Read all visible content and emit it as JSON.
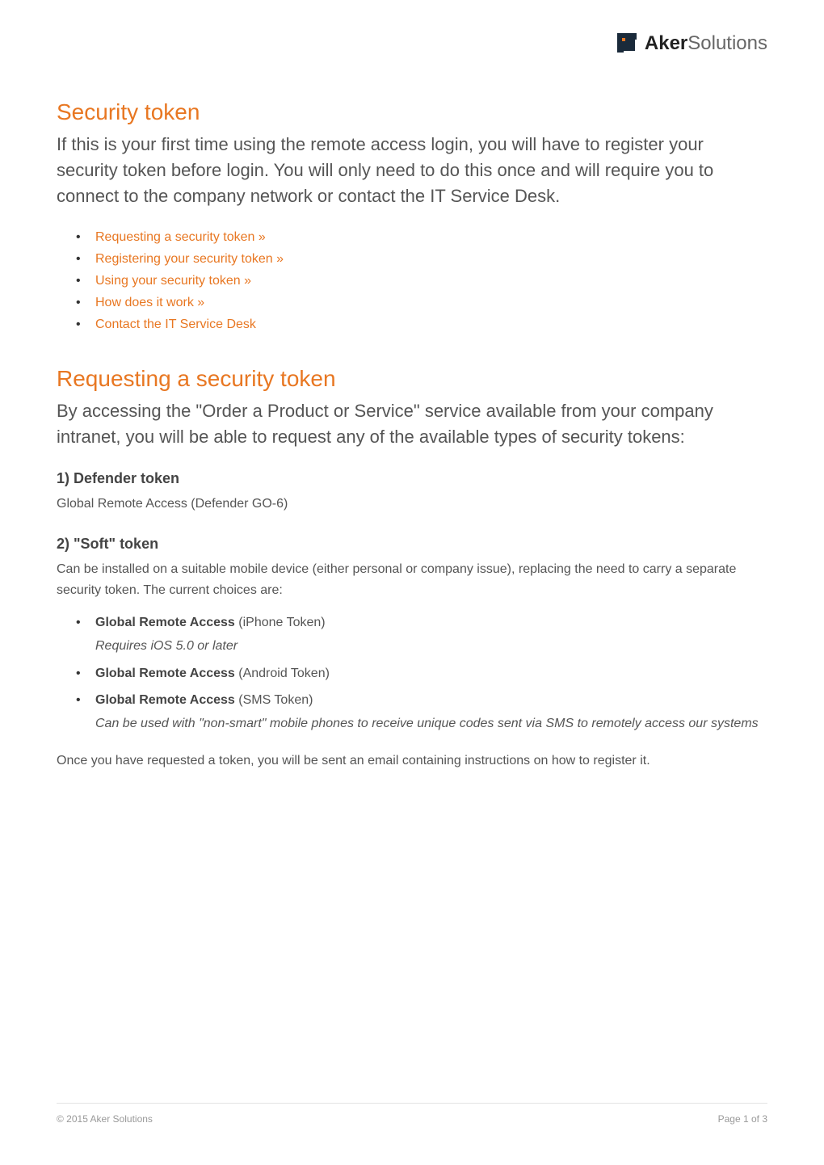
{
  "logo": {
    "brand_bold": "Aker",
    "brand_light": "Solutions"
  },
  "section1": {
    "title": "Security token",
    "intro": "If this is your first time using the remote access login, you will have to register your security token before login. You will only need to do this once and will require you to connect to the company network or contact the IT Service Desk.",
    "links": [
      "Requesting a security token »",
      "Registering your security token »",
      "Using your security token »",
      "How does it work »",
      "Contact the IT Service Desk"
    ]
  },
  "section2": {
    "title": "Requesting a security token",
    "intro": "By accessing the \"Order a Product or Service\" service available from your company intranet, you will be able to request any of the available types of security tokens:",
    "sub1": {
      "heading": "1) Defender token",
      "body": "Global Remote Access (Defender GO-6)"
    },
    "sub2": {
      "heading": "2) \"Soft\" token",
      "body": "Can be installed on a suitable mobile device (either personal or company issue), replacing the need to carry a separate security token. The current choices are:",
      "items": [
        {
          "bold": "Global Remote Access",
          "rest": " (iPhone Token)",
          "italic": "Requires iOS 5.0 or later"
        },
        {
          "bold": "Global Remote Access",
          "rest": " (Android Token)",
          "italic": ""
        },
        {
          "bold": "Global Remote Access",
          "rest": " (SMS Token)",
          "italic": "Can be used with \"non-smart\" mobile phones to receive unique codes sent via SMS to remotely access our systems"
        }
      ]
    },
    "closing": "Once you have requested a token, you will be sent an email containing instructions on how to register it."
  },
  "footer": {
    "copyright": "© 2015 Aker Solutions",
    "page": "Page 1 of 3"
  }
}
